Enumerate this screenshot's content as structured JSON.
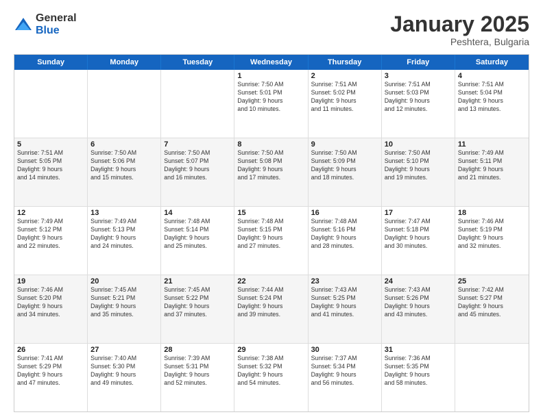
{
  "logo": {
    "general": "General",
    "blue": "Blue"
  },
  "title": "January 2025",
  "location": "Peshtera, Bulgaria",
  "days": [
    "Sunday",
    "Monday",
    "Tuesday",
    "Wednesday",
    "Thursday",
    "Friday",
    "Saturday"
  ],
  "weeks": [
    [
      {
        "day": "",
        "lines": []
      },
      {
        "day": "",
        "lines": []
      },
      {
        "day": "",
        "lines": []
      },
      {
        "day": "1",
        "lines": [
          "Sunrise: 7:50 AM",
          "Sunset: 5:01 PM",
          "Daylight: 9 hours",
          "and 10 minutes."
        ]
      },
      {
        "day": "2",
        "lines": [
          "Sunrise: 7:51 AM",
          "Sunset: 5:02 PM",
          "Daylight: 9 hours",
          "and 11 minutes."
        ]
      },
      {
        "day": "3",
        "lines": [
          "Sunrise: 7:51 AM",
          "Sunset: 5:03 PM",
          "Daylight: 9 hours",
          "and 12 minutes."
        ]
      },
      {
        "day": "4",
        "lines": [
          "Sunrise: 7:51 AM",
          "Sunset: 5:04 PM",
          "Daylight: 9 hours",
          "and 13 minutes."
        ]
      }
    ],
    [
      {
        "day": "5",
        "lines": [
          "Sunrise: 7:51 AM",
          "Sunset: 5:05 PM",
          "Daylight: 9 hours",
          "and 14 minutes."
        ]
      },
      {
        "day": "6",
        "lines": [
          "Sunrise: 7:50 AM",
          "Sunset: 5:06 PM",
          "Daylight: 9 hours",
          "and 15 minutes."
        ]
      },
      {
        "day": "7",
        "lines": [
          "Sunrise: 7:50 AM",
          "Sunset: 5:07 PM",
          "Daylight: 9 hours",
          "and 16 minutes."
        ]
      },
      {
        "day": "8",
        "lines": [
          "Sunrise: 7:50 AM",
          "Sunset: 5:08 PM",
          "Daylight: 9 hours",
          "and 17 minutes."
        ]
      },
      {
        "day": "9",
        "lines": [
          "Sunrise: 7:50 AM",
          "Sunset: 5:09 PM",
          "Daylight: 9 hours",
          "and 18 minutes."
        ]
      },
      {
        "day": "10",
        "lines": [
          "Sunrise: 7:50 AM",
          "Sunset: 5:10 PM",
          "Daylight: 9 hours",
          "and 19 minutes."
        ]
      },
      {
        "day": "11",
        "lines": [
          "Sunrise: 7:49 AM",
          "Sunset: 5:11 PM",
          "Daylight: 9 hours",
          "and 21 minutes."
        ]
      }
    ],
    [
      {
        "day": "12",
        "lines": [
          "Sunrise: 7:49 AM",
          "Sunset: 5:12 PM",
          "Daylight: 9 hours",
          "and 22 minutes."
        ]
      },
      {
        "day": "13",
        "lines": [
          "Sunrise: 7:49 AM",
          "Sunset: 5:13 PM",
          "Daylight: 9 hours",
          "and 24 minutes."
        ]
      },
      {
        "day": "14",
        "lines": [
          "Sunrise: 7:48 AM",
          "Sunset: 5:14 PM",
          "Daylight: 9 hours",
          "and 25 minutes."
        ]
      },
      {
        "day": "15",
        "lines": [
          "Sunrise: 7:48 AM",
          "Sunset: 5:15 PM",
          "Daylight: 9 hours",
          "and 27 minutes."
        ]
      },
      {
        "day": "16",
        "lines": [
          "Sunrise: 7:48 AM",
          "Sunset: 5:16 PM",
          "Daylight: 9 hours",
          "and 28 minutes."
        ]
      },
      {
        "day": "17",
        "lines": [
          "Sunrise: 7:47 AM",
          "Sunset: 5:18 PM",
          "Daylight: 9 hours",
          "and 30 minutes."
        ]
      },
      {
        "day": "18",
        "lines": [
          "Sunrise: 7:46 AM",
          "Sunset: 5:19 PM",
          "Daylight: 9 hours",
          "and 32 minutes."
        ]
      }
    ],
    [
      {
        "day": "19",
        "lines": [
          "Sunrise: 7:46 AM",
          "Sunset: 5:20 PM",
          "Daylight: 9 hours",
          "and 34 minutes."
        ]
      },
      {
        "day": "20",
        "lines": [
          "Sunrise: 7:45 AM",
          "Sunset: 5:21 PM",
          "Daylight: 9 hours",
          "and 35 minutes."
        ]
      },
      {
        "day": "21",
        "lines": [
          "Sunrise: 7:45 AM",
          "Sunset: 5:22 PM",
          "Daylight: 9 hours",
          "and 37 minutes."
        ]
      },
      {
        "day": "22",
        "lines": [
          "Sunrise: 7:44 AM",
          "Sunset: 5:24 PM",
          "Daylight: 9 hours",
          "and 39 minutes."
        ]
      },
      {
        "day": "23",
        "lines": [
          "Sunrise: 7:43 AM",
          "Sunset: 5:25 PM",
          "Daylight: 9 hours",
          "and 41 minutes."
        ]
      },
      {
        "day": "24",
        "lines": [
          "Sunrise: 7:43 AM",
          "Sunset: 5:26 PM",
          "Daylight: 9 hours",
          "and 43 minutes."
        ]
      },
      {
        "day": "25",
        "lines": [
          "Sunrise: 7:42 AM",
          "Sunset: 5:27 PM",
          "Daylight: 9 hours",
          "and 45 minutes."
        ]
      }
    ],
    [
      {
        "day": "26",
        "lines": [
          "Sunrise: 7:41 AM",
          "Sunset: 5:29 PM",
          "Daylight: 9 hours",
          "and 47 minutes."
        ]
      },
      {
        "day": "27",
        "lines": [
          "Sunrise: 7:40 AM",
          "Sunset: 5:30 PM",
          "Daylight: 9 hours",
          "and 49 minutes."
        ]
      },
      {
        "day": "28",
        "lines": [
          "Sunrise: 7:39 AM",
          "Sunset: 5:31 PM",
          "Daylight: 9 hours",
          "and 52 minutes."
        ]
      },
      {
        "day": "29",
        "lines": [
          "Sunrise: 7:38 AM",
          "Sunset: 5:32 PM",
          "Daylight: 9 hours",
          "and 54 minutes."
        ]
      },
      {
        "day": "30",
        "lines": [
          "Sunrise: 7:37 AM",
          "Sunset: 5:34 PM",
          "Daylight: 9 hours",
          "and 56 minutes."
        ]
      },
      {
        "day": "31",
        "lines": [
          "Sunrise: 7:36 AM",
          "Sunset: 5:35 PM",
          "Daylight: 9 hours",
          "and 58 minutes."
        ]
      },
      {
        "day": "",
        "lines": []
      }
    ]
  ]
}
